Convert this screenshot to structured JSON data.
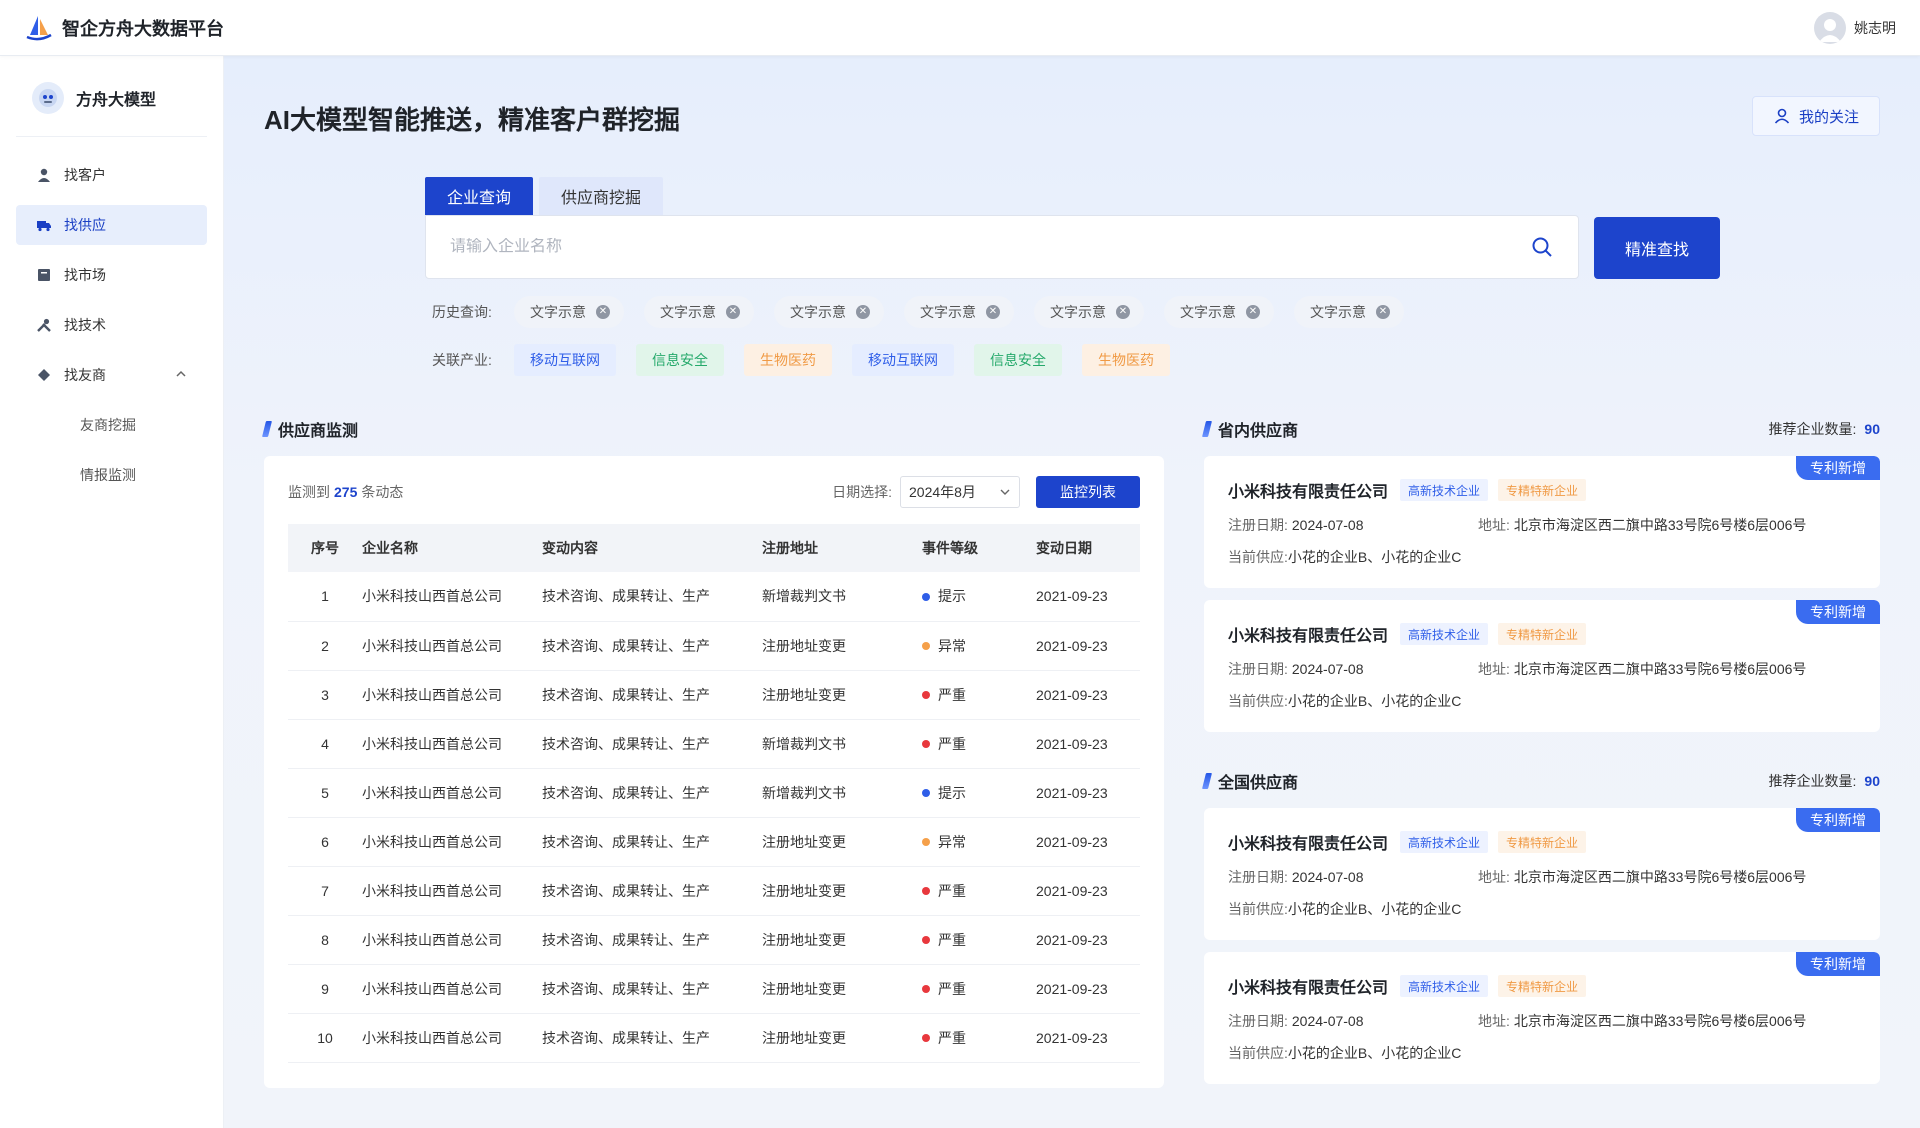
{
  "app": {
    "title": "智企方舟大数据平台",
    "user_name": "姚志明"
  },
  "sidebar": {
    "title": "方舟大模型",
    "items": [
      {
        "label": "找客户",
        "icon": "user-icon"
      },
      {
        "label": "找供应",
        "icon": "truck-icon"
      },
      {
        "label": "找市场",
        "icon": "book-icon"
      },
      {
        "label": "找技术",
        "icon": "tools-icon"
      },
      {
        "label": "找友商",
        "icon": "diamond-icon"
      }
    ],
    "sub_items": [
      {
        "label": "友商挖掘"
      },
      {
        "label": "情报监测"
      }
    ],
    "active_index": 1
  },
  "main": {
    "page_title": "AI大模型智能推送，精准客户群挖掘",
    "follow_label": "我的关注",
    "tabs": [
      {
        "label": "企业查询"
      },
      {
        "label": "供应商挖掘"
      }
    ],
    "search": {
      "placeholder": "请输入企业名称",
      "value": "",
      "button_label": "精准查找"
    },
    "history": {
      "label": "历史查询:",
      "tags": [
        "文字示意",
        "文字示意",
        "文字示意",
        "文字示意",
        "文字示意",
        "文字示意",
        "文字示意"
      ]
    },
    "industry": {
      "label": "关联产业:",
      "tags": [
        {
          "label": "移动互联网",
          "color": "blue"
        },
        {
          "label": "信息安全",
          "color": "green"
        },
        {
          "label": "生物医药",
          "color": "orange"
        },
        {
          "label": "移动互联网",
          "color": "blue"
        },
        {
          "label": "信息安全",
          "color": "green"
        },
        {
          "label": "生物医药",
          "color": "orange"
        }
      ]
    }
  },
  "monitor": {
    "title": "供应商监测",
    "count_prefix": "监测到",
    "count": "275",
    "count_suffix": "条动态",
    "date_label": "日期选择:",
    "date_value": "2024年8月",
    "list_button": "监控列表",
    "columns": [
      "序号",
      "企业名称",
      "变动内容",
      "注册地址",
      "事件等级",
      "变动日期"
    ],
    "level_colors": {
      "提示": "#2f5ee8",
      "异常": "#f5a04a",
      "严重": "#e8383d"
    },
    "rows": [
      {
        "no": "1",
        "name": "小米科技山西首总公司",
        "change": "技术咨询、成果转让、生产",
        "addr": "新增裁判文书",
        "level": "提示",
        "date": "2021-09-23"
      },
      {
        "no": "2",
        "name": "小米科技山西首总公司",
        "change": "技术咨询、成果转让、生产",
        "addr": "注册地址变更",
        "level": "异常",
        "date": "2021-09-23"
      },
      {
        "no": "3",
        "name": "小米科技山西首总公司",
        "change": "技术咨询、成果转让、生产",
        "addr": "注册地址变更",
        "level": "严重",
        "date": "2021-09-23"
      },
      {
        "no": "4",
        "name": "小米科技山西首总公司",
        "change": "技术咨询、成果转让、生产",
        "addr": "新增裁判文书",
        "level": "严重",
        "date": "2021-09-23"
      },
      {
        "no": "5",
        "name": "小米科技山西首总公司",
        "change": "技术咨询、成果转让、生产",
        "addr": "新增裁判文书",
        "level": "提示",
        "date": "2021-09-23"
      },
      {
        "no": "6",
        "name": "小米科技山西首总公司",
        "change": "技术咨询、成果转让、生产",
        "addr": "注册地址变更",
        "level": "异常",
        "date": "2021-09-23"
      },
      {
        "no": "7",
        "name": "小米科技山西首总公司",
        "change": "技术咨询、成果转让、生产",
        "addr": "注册地址变更",
        "level": "严重",
        "date": "2021-09-23"
      },
      {
        "no": "8",
        "name": "小米科技山西首总公司",
        "change": "技术咨询、成果转让、生产",
        "addr": "注册地址变更",
        "level": "严重",
        "date": "2021-09-23"
      },
      {
        "no": "9",
        "name": "小米科技山西首总公司",
        "change": "技术咨询、成果转让、生产",
        "addr": "注册地址变更",
        "level": "严重",
        "date": "2021-09-23"
      },
      {
        "no": "10",
        "name": "小米科技山西首总公司",
        "change": "技术咨询、成果转让、生产",
        "addr": "注册地址变更",
        "level": "严重",
        "date": "2021-09-23"
      }
    ]
  },
  "suppliers": {
    "count_label": "推荐企业数量:",
    "sections": [
      {
        "title": "省内供应商",
        "count": "90",
        "cards": [
          {
            "name": "小米科技有限责任公司",
            "tags": [
              "高新技术企业",
              "专精特新企业"
            ],
            "ribbon": "专利新增",
            "reg_label": "注册日期:",
            "reg_date": "2024-07-08",
            "addr_label": "地址:",
            "addr": "北京市海淀区西二旗中路33号院6号楼6层006号",
            "supply_label": "当前供应:",
            "supply": "小花的企业B、小花的企业C"
          },
          {
            "name": "小米科技有限责任公司",
            "tags": [
              "高新技术企业",
              "专精特新企业"
            ],
            "ribbon": "专利新增",
            "reg_label": "注册日期:",
            "reg_date": "2024-07-08",
            "addr_label": "地址:",
            "addr": "北京市海淀区西二旗中路33号院6号楼6层006号",
            "supply_label": "当前供应:",
            "supply": "小花的企业B、小花的企业C"
          }
        ]
      },
      {
        "title": "全国供应商",
        "count": "90",
        "cards": [
          {
            "name": "小米科技有限责任公司",
            "tags": [
              "高新技术企业",
              "专精特新企业"
            ],
            "ribbon": "专利新增",
            "reg_label": "注册日期:",
            "reg_date": "2024-07-08",
            "addr_label": "地址:",
            "addr": "北京市海淀区西二旗中路33号院6号楼6层006号",
            "supply_label": "当前供应:",
            "supply": "小花的企业B、小花的企业C"
          },
          {
            "name": "小米科技有限责任公司",
            "tags": [
              "高新技术企业",
              "专精特新企业"
            ],
            "ribbon": "专利新增",
            "reg_label": "注册日期:",
            "reg_date": "2024-07-08",
            "addr_label": "地址:",
            "addr": "北京市海淀区西二旗中路33号院6号楼6层006号",
            "supply_label": "当前供应:",
            "supply": "小花的企业B、小花的企业C"
          }
        ]
      }
    ]
  }
}
